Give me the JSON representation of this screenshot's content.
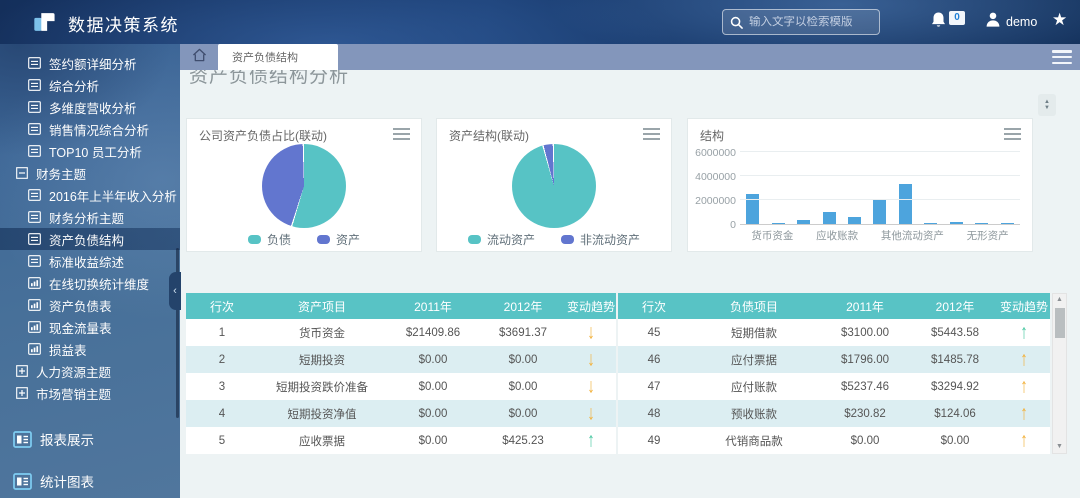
{
  "colors": {
    "teal": "#57c3c5",
    "blue": "#6276cf",
    "bar_blue": "#4da4dd",
    "orange": "#f2b23e",
    "green": "#4cc8a3",
    "table_header": "#58c3c5",
    "stripe": "#dceef2"
  },
  "header": {
    "app_title": "数据决策系统",
    "search_placeholder": "输入文字以检索模版",
    "notification_count": "0",
    "username": "demo"
  },
  "tabbar": {
    "active_tab": "资产负债结构"
  },
  "page": {
    "title": "资产负债结构分析"
  },
  "sidebar": {
    "items": [
      {
        "label": "签约额详细分析",
        "type": "report",
        "indent": 2,
        "active": false
      },
      {
        "label": "综合分析",
        "type": "report",
        "indent": 2,
        "active": false
      },
      {
        "label": "多维度营收分析",
        "type": "report",
        "indent": 2,
        "active": false
      },
      {
        "label": "销售情况综合分析",
        "type": "report",
        "indent": 2,
        "active": false
      },
      {
        "label": "TOP10 员工分析",
        "type": "report",
        "indent": 2,
        "active": false
      },
      {
        "label": "财务主题",
        "type": "group-open",
        "indent": 1,
        "active": false
      },
      {
        "label": "2016年上半年收入分析",
        "type": "report",
        "indent": 2,
        "active": false
      },
      {
        "label": "财务分析主题",
        "type": "report",
        "indent": 2,
        "active": false
      },
      {
        "label": "资产负债结构",
        "type": "report",
        "indent": 2,
        "active": true
      },
      {
        "label": "标准收益综述",
        "type": "report",
        "indent": 2,
        "active": false
      },
      {
        "label": "在线切换统计维度",
        "type": "chart",
        "indent": 2,
        "active": false
      },
      {
        "label": "资产负债表",
        "type": "chart",
        "indent": 2,
        "active": false
      },
      {
        "label": "现金流量表",
        "type": "chart",
        "indent": 2,
        "active": false
      },
      {
        "label": "损益表",
        "type": "chart",
        "indent": 2,
        "active": false
      },
      {
        "label": "人力资源主题",
        "type": "group-closed",
        "indent": 1,
        "active": false
      },
      {
        "label": "市场营销主题",
        "type": "group-closed",
        "indent": 1,
        "active": false
      },
      {
        "label": "报表展示",
        "type": "section",
        "indent": 0,
        "active": false
      },
      {
        "label": "统计图表",
        "type": "section",
        "indent": 0,
        "active": false
      }
    ]
  },
  "chart_data": [
    {
      "type": "pie",
      "title": "公司资产负债占比(联动)",
      "legend_position": "bottom",
      "series": [
        {
          "name": "负债",
          "value": 55,
          "color": "#57c3c5"
        },
        {
          "name": "资产",
          "value": 45,
          "color": "#6276cf"
        }
      ],
      "unit": "percent"
    },
    {
      "type": "pie",
      "title": "资产结构(联动)",
      "legend_position": "bottom",
      "series": [
        {
          "name": "流动资产",
          "value": 96,
          "color": "#57c3c5"
        },
        {
          "name": "非流动资产",
          "value": 4,
          "color": "#6276cf"
        }
      ],
      "unit": "percent"
    },
    {
      "type": "bar",
      "title": "结构",
      "values": [
        2500000,
        80000,
        300000,
        1000000,
        600000,
        2100000,
        3300000,
        100000,
        150000,
        80000,
        100000
      ],
      "x_tick_labels": [
        "货币资金",
        "应收账款",
        "其他流动资产",
        "无形资产"
      ],
      "y_ticks": [
        0,
        2000000,
        4000000,
        6000000
      ],
      "ylim": [
        0,
        6000000
      ],
      "bar_color": "#4da4dd",
      "grid": true,
      "legend_position": "none"
    }
  ],
  "tables": {
    "left": {
      "headers": [
        "行次",
        "资产项目",
        "2011年",
        "2012年",
        "变动趋势"
      ],
      "rows": [
        {
          "cells": [
            "1",
            "货币资金",
            "$21409.86",
            "$3691.37"
          ],
          "trend": "down",
          "trend_color": "orange"
        },
        {
          "cells": [
            "2",
            "短期投资",
            "$0.00",
            "$0.00"
          ],
          "trend": "down",
          "trend_color": "orange"
        },
        {
          "cells": [
            "3",
            "短期投资跌价准备",
            "$0.00",
            "$0.00"
          ],
          "trend": "down",
          "trend_color": "orange"
        },
        {
          "cells": [
            "4",
            "短期投资净值",
            "$0.00",
            "$0.00"
          ],
          "trend": "down",
          "trend_color": "orange"
        },
        {
          "cells": [
            "5",
            "应收票据",
            "$0.00",
            "$425.23"
          ],
          "trend": "up",
          "trend_color": "green"
        }
      ]
    },
    "right": {
      "headers": [
        "行次",
        "负债项目",
        "2011年",
        "2012年",
        "变动趋势"
      ],
      "rows": [
        {
          "cells": [
            "45",
            "短期借款",
            "$3100.00",
            "$5443.58"
          ],
          "trend": "up",
          "trend_color": "green"
        },
        {
          "cells": [
            "46",
            "应付票据",
            "$1796.00",
            "$1485.78"
          ],
          "trend": "up",
          "trend_color": "orange"
        },
        {
          "cells": [
            "47",
            "应付账款",
            "$5237.46",
            "$3294.92"
          ],
          "trend": "up",
          "trend_color": "orange"
        },
        {
          "cells": [
            "48",
            "预收账款",
            "$230.82",
            "$124.06"
          ],
          "trend": "up",
          "trend_color": "orange"
        },
        {
          "cells": [
            "49",
            "代销商品款",
            "$0.00",
            "$0.00"
          ],
          "trend": "up",
          "trend_color": "orange"
        }
      ]
    }
  }
}
